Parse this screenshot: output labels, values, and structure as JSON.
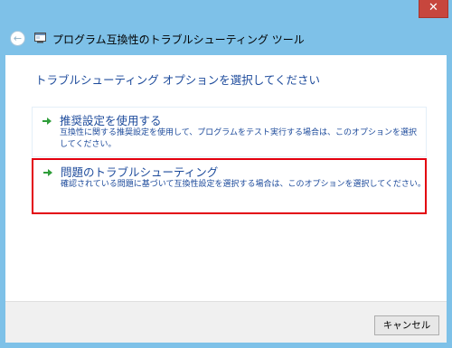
{
  "window": {
    "title": "プログラム互換性のトラブルシューティング ツール",
    "close_label": "✕",
    "back_label": "←"
  },
  "main": {
    "instruction": "トラブルシューティング オプションを選択してください",
    "options": [
      {
        "title": "推奨設定を使用する",
        "description": "互換性に関する推奨設定を使用して、プログラムをテスト実行する場合は、このオプションを選択してください。",
        "icon": "green-arrow-icon"
      },
      {
        "title": "問題のトラブルシューティング",
        "description": "確認されている問題に基づいて互換性設定を選択する場合は、このオプションを選択してください。",
        "icon": "green-arrow-icon",
        "highlight_color": "#e3000f"
      }
    ]
  },
  "footer": {
    "cancel_label": "キャンセル"
  },
  "colors": {
    "frame": "#7ec1e8",
    "link_text": "#1c4a9b",
    "close_button": "#c7463d",
    "arrow": "#2f9e3a"
  }
}
